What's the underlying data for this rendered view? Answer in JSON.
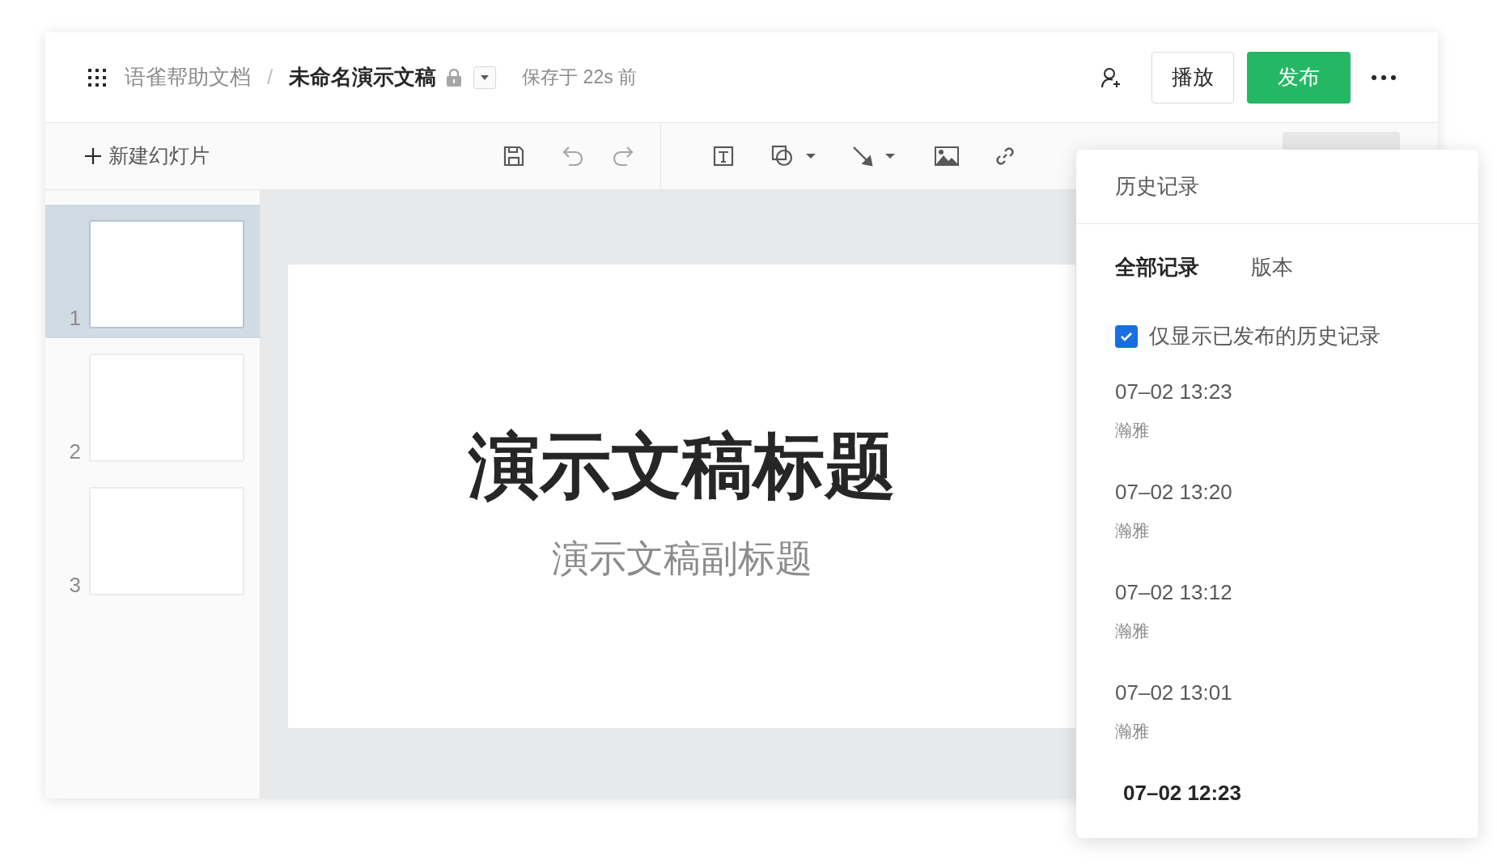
{
  "header": {
    "space": "语雀帮助文档",
    "separator": "/",
    "title": "未命名演示文稿",
    "locked": true,
    "save_status": "保存于 22s 前",
    "buttons": [
      {
        "label": "播放",
        "kind": "secondary"
      },
      {
        "label": "发布",
        "kind": "primary"
      }
    ]
  },
  "toolbar": {
    "new_slide": "新建幻灯片"
  },
  "slides": [
    {
      "number": "1",
      "selected": true
    },
    {
      "number": "2",
      "selected": false
    },
    {
      "number": "3",
      "selected": false
    }
  ],
  "slide": {
    "title": "演示文稿标题",
    "subtitle": "演示文稿副标题"
  },
  "history_panel": {
    "title": "历史记录",
    "tabs": [
      {
        "label": "全部记录",
        "selected": true
      },
      {
        "label": "版本",
        "selected": false
      }
    ],
    "published_only": {
      "label": "仅显示已发布的历史记录",
      "checked": true
    },
    "entries": [
      {
        "time": "07–02 13:23",
        "author": "瀚雅",
        "selected": false
      },
      {
        "time": "07–02 13:20",
        "author": "瀚雅",
        "selected": false
      },
      {
        "time": "07–02 13:12",
        "author": "瀚雅",
        "selected": false
      },
      {
        "time": "07–02 13:01",
        "author": "瀚雅",
        "selected": false
      },
      {
        "time": "07–02 12:23",
        "selected": true
      }
    ]
  }
}
